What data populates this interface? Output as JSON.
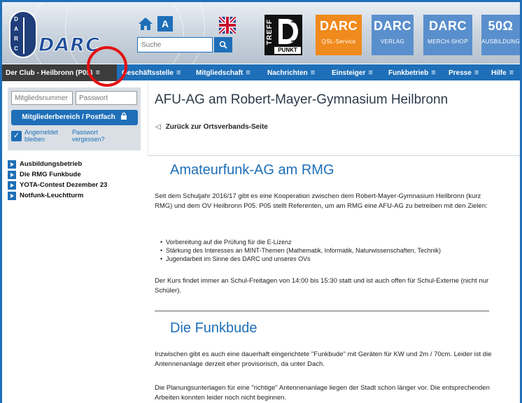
{
  "header": {
    "logo_text": "DARC",
    "logo_badge_letters": [
      "D",
      "A",
      "R",
      "C"
    ],
    "search_placeholder": "Suche",
    "treff_vertical": "TREFF",
    "treff_punkt": "PUNKT",
    "tiles": [
      {
        "big": "DARC",
        "small": "QSL-Service"
      },
      {
        "big": "DARC",
        "small": "VERLAG"
      },
      {
        "big": "DARC",
        "small": "MERCH-SHOP"
      },
      {
        "big": "50Ω",
        "small": "AUSBILDUNG"
      }
    ]
  },
  "nav": {
    "items": [
      "Der Club - Heilbronn (P05)",
      "Geschäftsstelle",
      "Mitgliedschaft",
      "Nachrichten",
      "Einsteiger",
      "Funkbetrieb",
      "Presse",
      "Hilfe"
    ],
    "burger": "≡"
  },
  "login": {
    "member_placeholder": "Mitgliedsnummer",
    "password_placeholder": "Passwort",
    "button_label": "Mitgliederbereich / Postfach",
    "remember_label": "Angemeldet bleiben",
    "forgot_label": "Passwort vergessen?",
    "remember_checked": true
  },
  "sidebar": {
    "items": [
      "Ausbildungsbetrieb",
      "Die RMG Funkbude",
      "YOTA-Contest Dezember 23",
      "Notfunk-Leuchtturm"
    ]
  },
  "main": {
    "title": "AFU-AG am Robert-Mayer-Gymnasium Heilbronn",
    "back_link": "Zurück zur Ortsverbands-Seite",
    "section1_heading": "Amateurfunk-AG am RMG",
    "section1_para": "Seit dem Schuljahr 2016/17 gibt es eine Kooperation zwischen dem Robert-Mayer-Gymnasium Heilbronn (kurz RMG) und dem OV Heilbronn P05. P05 stellt Referenten, um am RMG eine AFU-AG zu betreiben mit den Zielen:",
    "bullets": [
      "Vorbereitung auf die Prüfung für die E-Lizenz",
      "Stärkung des Interesses an MINT-Themen (Mathematik, Informatik, Naturwissenschaften, Technik)",
      "Jugendarbeit im Sinne des DARC und unseres OVs"
    ],
    "section1_para2": "Der Kurs findet immer an Schul-Freitagen von 14:00 bis 15:30 statt und ist auch offen für Schul-Externe (nicht nur Schüler).",
    "section2_heading": "Die Funkbude",
    "section2_para": "Inzwischen gibt es auch eine dauerhaft eingerichtete \"Funkbude\" mit Geräten für KW und 2m / 70cm. Leider ist die Antennenanlage derzeit eher provisorisch, da unter Dach.",
    "section2_para2": "Die Planungsunterlagen für eine \"richtige\" Antennenanlage liegen der Stadt schon länger vor. Die entsprechenden Arbeiten konnten leider noch nicht beginnen."
  },
  "colors": {
    "brand_blue": "#1e6fb8",
    "nav_dark": "#3c3c3c",
    "orange_tile": "#f08a1c",
    "light_blue_tile": "#5a8fcd",
    "annotation_red": "#e41010"
  }
}
